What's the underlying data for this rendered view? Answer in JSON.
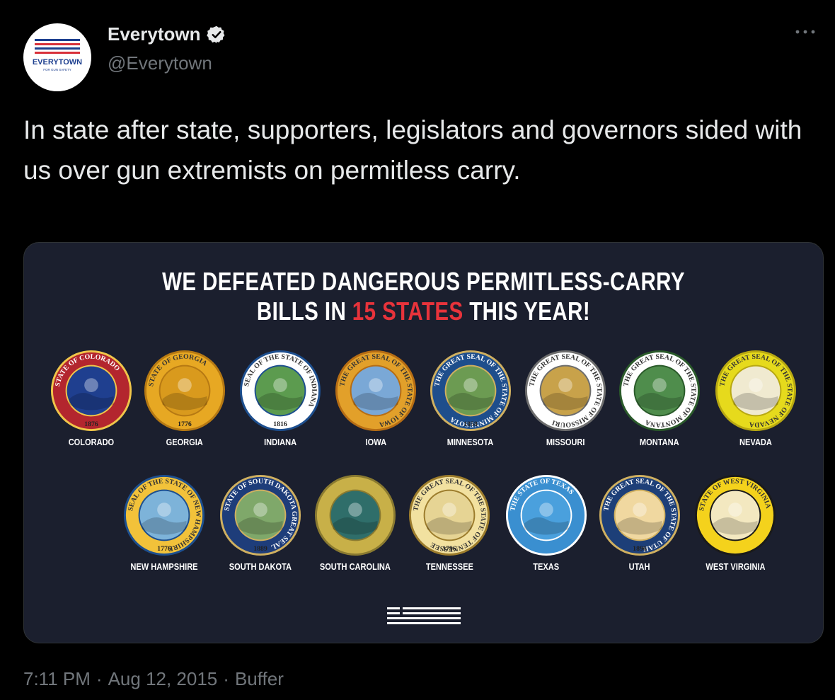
{
  "author": {
    "name": "Everytown",
    "handle": "@Everytown",
    "avatar_wordmark": "EVERYTOWN",
    "avatar_tagline": "FOR GUN SAFETY"
  },
  "tweet": {
    "text": "In state after state, supporters, legislators and governors sided with us over gun extremists on permitless carry."
  },
  "media": {
    "headline_line1": "WE DEFEATED DANGEROUS PERMITLESS-CARRY",
    "headline_line2_prefix": "BILLS IN ",
    "headline_line2_highlight": "15 STATES",
    "headline_line2_suffix": " THIS YEAR!",
    "highlight_color": "#e8333b",
    "background_color": "#1b1f2e",
    "seals": [
      {
        "label": "COLORADO",
        "ring": "#b3262e",
        "inner": "#1f3f8f",
        "rim": "#f0c64a",
        "text": "STATE OF COLORADO",
        "year": "1876"
      },
      {
        "label": "GEORGIA",
        "ring": "#e7a823",
        "inner": "#d99a1d",
        "rim": "#b67913",
        "text": "STATE OF GEORGIA",
        "year": "1776"
      },
      {
        "label": "INDIANA",
        "ring": "#ffffff",
        "inner": "#5c9b4f",
        "rim": "#1d4f8f",
        "text": "SEAL OF THE STATE OF INDIANA",
        "year": "1816"
      },
      {
        "label": "IOWA",
        "ring": "#e2a02a",
        "inner": "#7aa8d6",
        "rim": "#b66d14",
        "text": "THE GREAT SEAL OF THE STATE OF IOWA",
        "year": ""
      },
      {
        "label": "MINNESOTA",
        "ring": "#1e4e8c",
        "inner": "#6c9b52",
        "rim": "#d0b060",
        "text": "THE GREAT SEAL OF THE STATE OF MINNESOTA",
        "year": "1858"
      },
      {
        "label": "MISSOURI",
        "ring": "#ffffff",
        "inner": "#c8a24a",
        "rim": "#6d6d6d",
        "text": "THE GREAT SEAL OF THE STATE OF MISSOURI",
        "year": ""
      },
      {
        "label": "MONTANA",
        "ring": "#ffffff",
        "inner": "#4f8d4c",
        "rim": "#2a5a2a",
        "text": "THE GREAT SEAL OF THE STATE OF MONTANA",
        "year": ""
      },
      {
        "label": "NEVADA",
        "ring": "#e6da1c",
        "inner": "#f0ead0",
        "rim": "#b8a812",
        "text": "THE GREAT SEAL OF THE STATE OF NEVADA",
        "year": ""
      },
      {
        "label": "NEW HAMPSHIRE",
        "ring": "#f2c23a",
        "inner": "#7db3d9",
        "rim": "#1d4f8f",
        "text": "SEAL OF THE STATE OF NEW HAMPSHIRE",
        "year": "1776"
      },
      {
        "label": "SOUTH DAKOTA",
        "ring": "#1e3d7a",
        "inner": "#7fa86a",
        "rim": "#d0b060",
        "text": "STATE OF SOUTH DAKOTA GREAT SEAL",
        "year": "1889"
      },
      {
        "label": "SOUTH CAROLINA",
        "ring": "#c8b048",
        "inner": "#2f6e6a",
        "rim": "#8a7a30",
        "text": "",
        "year": ""
      },
      {
        "label": "TENNESSEE",
        "ring": "#f2e1a0",
        "inner": "#e6d494",
        "rim": "#9c7c2c",
        "text": "THE GREAT SEAL OF THE STATE OF TENNESSEE",
        "year": "1796"
      },
      {
        "label": "TEXAS",
        "ring": "#3a8fd0",
        "inner": "#4aa0dd",
        "rim": "#ffffff",
        "text": "THE STATE OF TEXAS",
        "year": ""
      },
      {
        "label": "UTAH",
        "ring": "#1d3f78",
        "inner": "#f0d8a0",
        "rim": "#d0b060",
        "text": "THE GREAT SEAL OF THE STATE OF UTAH",
        "year": "1896"
      },
      {
        "label": "WEST VIRGINIA",
        "ring": "#f4d21c",
        "inner": "#f3e8c0",
        "rim": "#1a1a1a",
        "text": "STATE OF WEST VIRGINIA",
        "year": ""
      }
    ]
  },
  "footer": {
    "time": "7:11 PM",
    "separator": "·",
    "date": "Aug 12, 2015",
    "source": "Buffer"
  },
  "icons": {
    "verified": "verified-badge-icon",
    "more": "more-options-icon"
  }
}
